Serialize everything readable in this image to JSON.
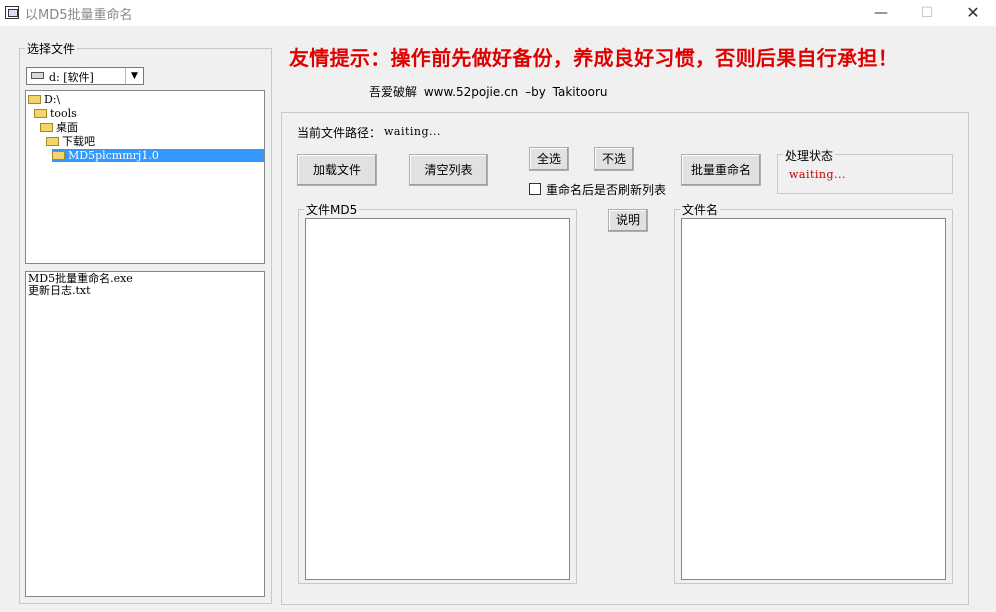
{
  "window": {
    "title": "以MD5批量重命名",
    "min_glyph": "—",
    "max_glyph": "☐",
    "close_glyph": "✕"
  },
  "left_panel": {
    "group_label": "选择文件",
    "drive": {
      "value": "d: [软件]",
      "arrow_glyph": "▼"
    },
    "tree": [
      {
        "label": "D:\\",
        "depth": 0,
        "selected": false
      },
      {
        "label": "tools",
        "depth": 1,
        "selected": false
      },
      {
        "label": "桌面",
        "depth": 2,
        "selected": false
      },
      {
        "label": "下载吧",
        "depth": 3,
        "selected": false
      },
      {
        "label": "MD5plcmmrj1.0",
        "depth": 4,
        "selected": true
      }
    ],
    "files": [
      "MD5批量重命名.exe",
      "更新日志.txt"
    ]
  },
  "header": {
    "warning": "友情提示：操作前先做好备份，养成良好习惯，否则后果自行承担！",
    "credit": "吾爱破解  www.52pojie.cn  –by Takitooru"
  },
  "main": {
    "path_label": "当前文件路径：",
    "path_value": "waiting...",
    "buttons": {
      "load": "加载文件",
      "clear": "清空列表",
      "select_all": "全选",
      "select_none": "不选",
      "batch_rename": "批量重命名",
      "help": "说明"
    },
    "refresh_checkbox": {
      "label": "重命名后是否刷新列表",
      "checked": false
    },
    "status": {
      "label": "处理状态",
      "value": "waiting..."
    },
    "md5_list": {
      "label": "文件MD5",
      "items": []
    },
    "names_list": {
      "label": "文件名",
      "items": []
    }
  },
  "colors": {
    "warning": "#e00000",
    "status_value": "#c00000",
    "selection": "#3399ff"
  }
}
